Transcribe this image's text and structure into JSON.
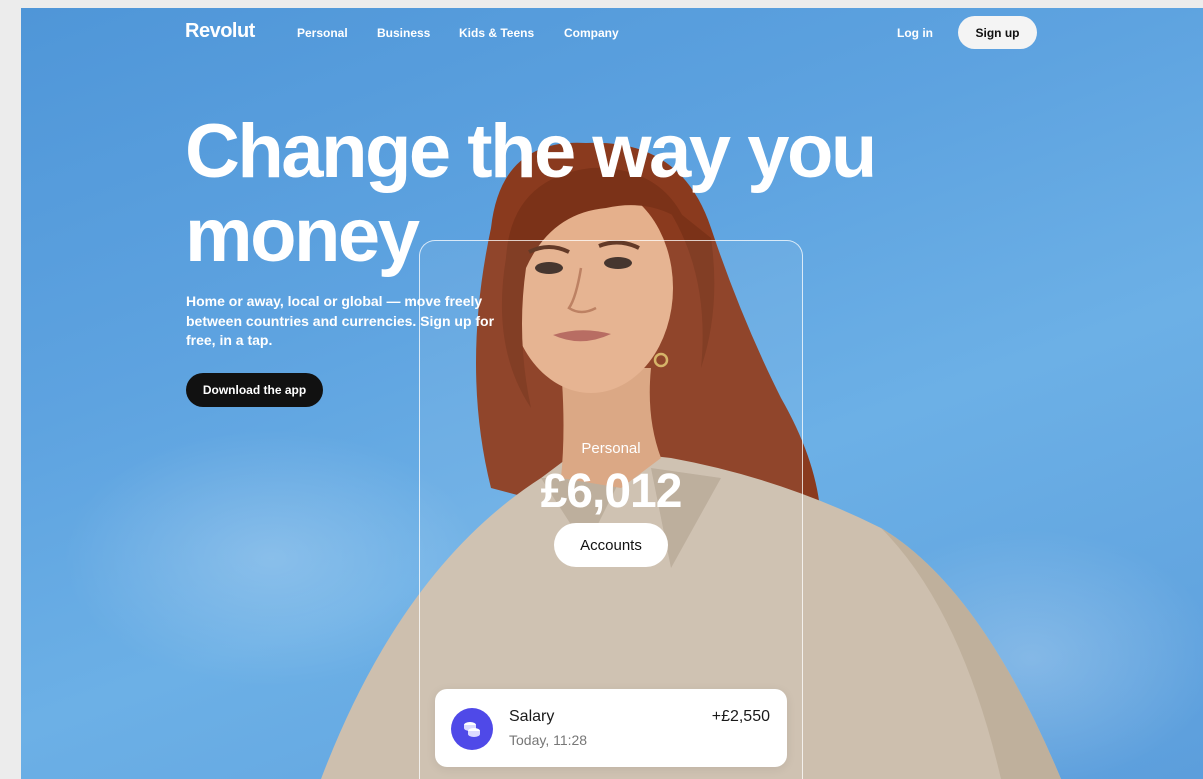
{
  "nav": {
    "logo": "Revolut",
    "links": [
      "Personal",
      "Business",
      "Kids & Teens",
      "Company"
    ],
    "login": "Log in",
    "signup": "Sign up"
  },
  "hero": {
    "headline_line1": "Change the way you",
    "headline_line2": "money",
    "subtext": "Home or away, local or global — move freely between countries and currencies. Sign up for free, in a tap.",
    "download_button": "Download the app"
  },
  "card": {
    "label": "Personal",
    "amount": "£6,012",
    "accounts_button": "Accounts",
    "transaction": {
      "icon": "coins-icon",
      "title": "Salary",
      "time": "Today, 11:28",
      "amount": "+£2,550"
    }
  },
  "colors": {
    "sky": "#5ea3e0",
    "hair": "#8a3a1e",
    "shirt": "#cdbfae",
    "accent": "#4f49e8"
  }
}
